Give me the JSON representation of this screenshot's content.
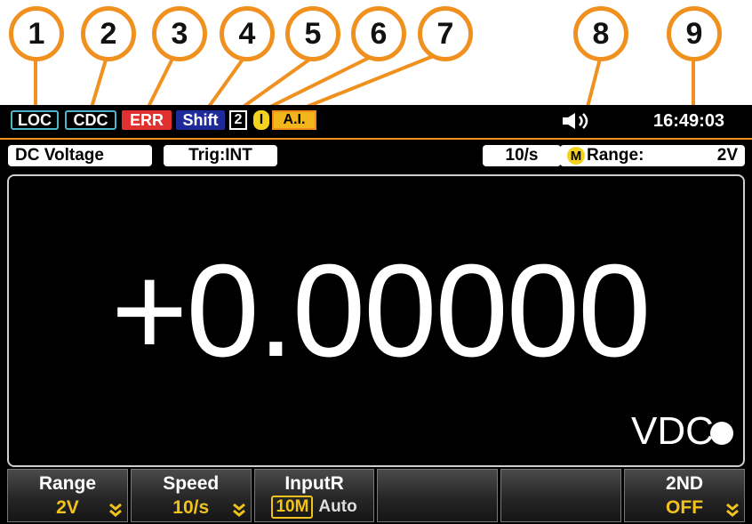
{
  "callouts": [
    "1",
    "2",
    "3",
    "4",
    "5",
    "6",
    "7",
    "8",
    "9"
  ],
  "status": {
    "loc": "LOC",
    "cdc": "CDC",
    "err": "ERR",
    "shift": "Shift",
    "two": "2",
    "i": "I",
    "ai": "A.I.",
    "speaker_icon": "speaker-icon",
    "time": "16:49:03"
  },
  "info": {
    "function": "DC Voltage",
    "trigger": "Trig:INT",
    "rate": "10/s",
    "m_icon": "M",
    "range_label": "Range:",
    "range_value": "2V"
  },
  "reading": {
    "value": "+0.00000",
    "unit": "VDC"
  },
  "softkeys": [
    {
      "label": "Range",
      "value": "2V"
    },
    {
      "label": "Speed",
      "value": "10/s"
    },
    {
      "label": "InputR",
      "options": [
        "10M",
        "Auto"
      ]
    },
    {
      "label": "",
      "value": ""
    },
    {
      "label": "",
      "value": ""
    },
    {
      "label": "2ND",
      "value": "OFF"
    }
  ],
  "colors": {
    "accent": "#f0901e",
    "status_teal": "#4fb8c8",
    "error_red": "#e03030",
    "shift_blue": "#1e2a9a",
    "highlight_yellow": "#f2c21c"
  }
}
